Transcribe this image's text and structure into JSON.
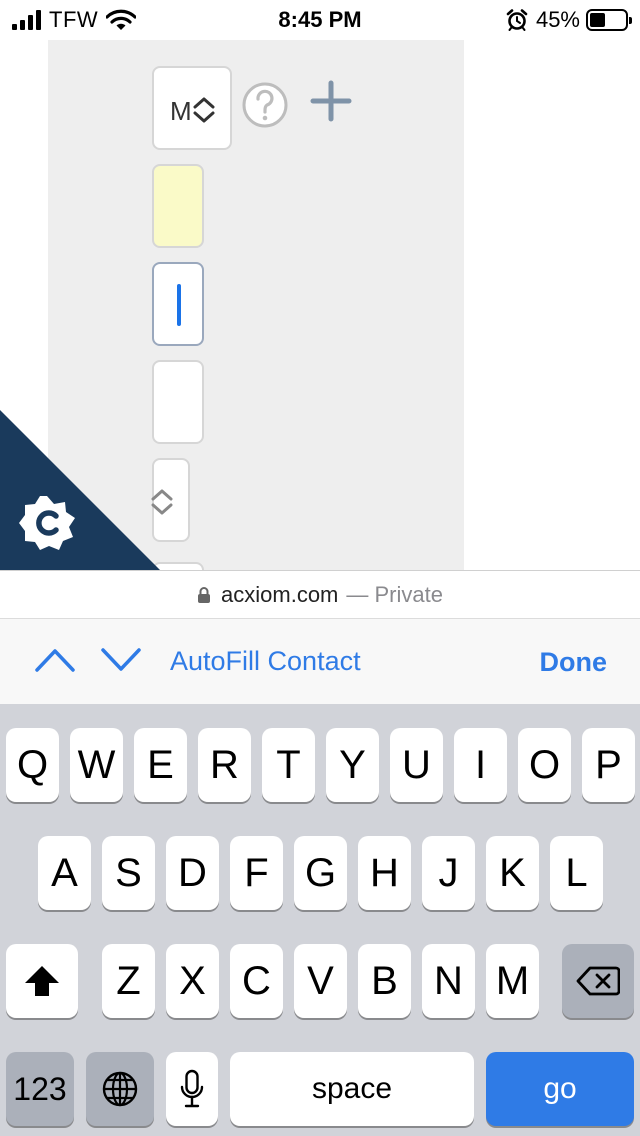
{
  "status_bar": {
    "carrier": "TFW",
    "time": "8:45 PM",
    "battery_percent": "45%",
    "battery_level": 0.45
  },
  "form": {
    "select_value": "M"
  },
  "url_bar": {
    "host": "acxiom.com",
    "mode": "— Private"
  },
  "form_assistant": {
    "autofill_label": "AutoFill Contact",
    "done_label": "Done"
  },
  "keyboard": {
    "row1": [
      "Q",
      "W",
      "E",
      "R",
      "T",
      "Y",
      "U",
      "I",
      "O",
      "P"
    ],
    "row2": [
      "A",
      "S",
      "D",
      "F",
      "G",
      "H",
      "J",
      "K",
      "L"
    ],
    "row3": [
      "Z",
      "X",
      "C",
      "V",
      "B",
      "N",
      "M"
    ],
    "numbers_label": "123",
    "space_label": "space",
    "go_label": "go"
  },
  "colors": {
    "accent": "#2f7be6",
    "badge": "#1a3a5c",
    "autofilled_field": "#fafac8",
    "keyboard_bg": "#d1d3d9"
  }
}
